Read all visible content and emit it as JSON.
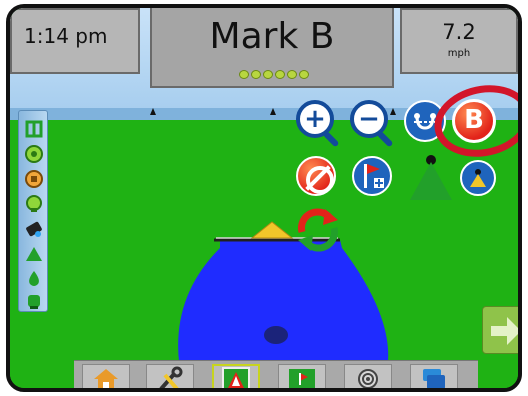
{
  "status": {
    "time": "1:14 pm",
    "guidance_mode": "Mark B",
    "speed_value": "7.2",
    "speed_unit": "mph",
    "lightbar_leds_lit": 6
  },
  "colors": {
    "field": "#1fb214",
    "sky": "#b8d8f4",
    "coverage": "#1f2cff",
    "accent_red": "#e2231a",
    "accent_blue": "#1f64bc",
    "active_tab_border": "#c7d41e"
  },
  "map_buttons": {
    "zoom_in": "zoom-in-icon",
    "zoom_out": "zoom-out-icon",
    "mark_ab": "mark-ab-icon",
    "mark_b_label": "B",
    "cancel": "cancel-icon",
    "add_marker": "flag-plus-icon",
    "view_mode": "vehicle-view-icon",
    "perspective": "camera-icon",
    "reset": "refresh-icon"
  },
  "sidebar": {
    "items": [
      "guidance-icon",
      "target-icon",
      "boom-icon",
      "sensor-icon",
      "tilt-icon",
      "arrow-up-icon",
      "drop-icon",
      "tank-icon"
    ]
  },
  "toolbar": {
    "tabs": [
      "home-icon",
      "tools-icon",
      "vehicle-view-icon",
      "field-view-icon",
      "gps-icon",
      "layers-icon"
    ],
    "active_tab": 2
  },
  "next_button": "arrow-right-icon"
}
